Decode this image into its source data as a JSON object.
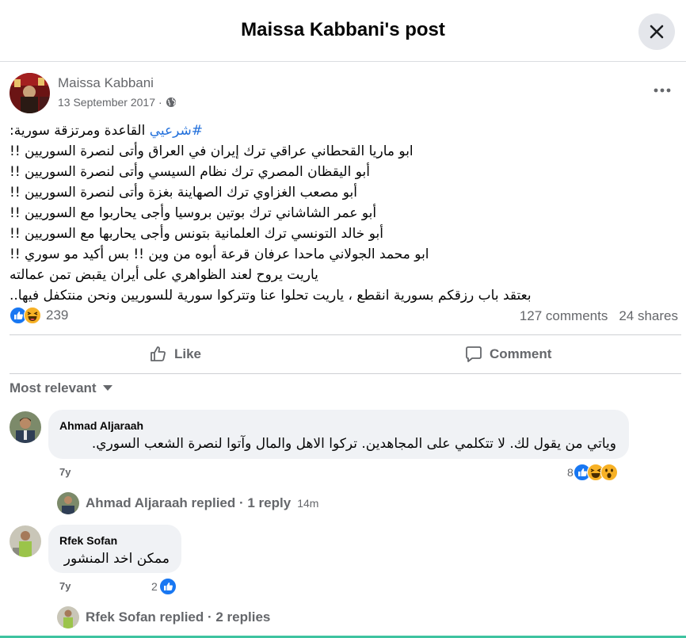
{
  "header": {
    "title": "Maissa Kabbani's post"
  },
  "post": {
    "author": "Maissa Kabbani",
    "date": "13 September 2017",
    "date_sep": "·",
    "hashtag": "#شرعيي",
    "lines": [
      " القاعدة ومرتزقة سورية:",
      "ابو ماريا القحطاني عراقي ترك إيران في العراق وأتى لنصرة السوريين !!",
      "أبو اليقظان المصري  ترك نظام السيسي وأتى لنصرة السوريين !!",
      "أبو مصعب الغزاوي ترك الصهاينة بغزة وأتى لنصرة السوريين !!",
      "أبو عمر الشاشاني ترك بوتين بروسيا وأجى يحاربوا مع السوريين !!",
      "أبو خالد التونسي ترك العلمانية بتونس وأجى يحاربها مع السوريين !!",
      "ابو محمد الجولاني ماحدا عرفان قرعة أبوه من وين !!  بس أكيد مو سوري !!",
      "ياريت يروح لعند الظواهري على أيران يقبض تمن عمالته",
      "بعتقد باب رزقكم بسورية انقطع ، ياريت تحلوا عنا وتتركوا سورية للسوريين ونحن منتكفل فيها.."
    ],
    "reaction_count": "239",
    "comments_count": "127 comments",
    "shares_count": "24 shares"
  },
  "actions": {
    "like": "Like",
    "comment": "Comment"
  },
  "sort_label": "Most relevant",
  "comments": [
    {
      "name": "Ahmad Aljaraah",
      "text": "وياتي من يقول لك. لا تتكلمي على المجاهدين. تركوا الاهل والمال وآتوا لنصرة الشعب السوري.",
      "time": "7y",
      "reactions": "8",
      "reply_label": "Ahmad Aljaraah replied · 1 reply",
      "reply_time": "14m"
    },
    {
      "name": "Rfek Sofan",
      "text": "ممكن اخد المنشور",
      "time": "7y",
      "reactions": "2",
      "reply_label": "Rfek Sofan replied · 2 replies"
    }
  ],
  "colors": {
    "accent": "#216fdb",
    "like_blue": "#1877f2",
    "haha_yellow": "#f7b125",
    "muted": "#65676b",
    "bubble": "#f0f2f5"
  },
  "icons": [
    "close-icon",
    "globe-icon",
    "more-icon",
    "like-reaction-icon",
    "haha-reaction-icon",
    "wow-reaction-icon",
    "thumbs-up-icon",
    "comment-bubble-icon",
    "caret-down-icon"
  ]
}
